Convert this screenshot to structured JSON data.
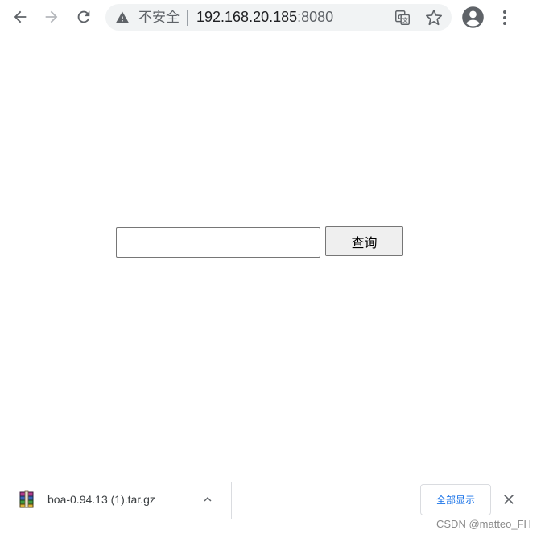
{
  "toolbar": {
    "back_icon": "arrow-back-icon",
    "forward_icon": "arrow-forward-icon",
    "reload_icon": "reload-icon",
    "omnibox": {
      "security_icon": "warning-triangle-icon",
      "security_label": "不安全",
      "url_host": "192.168.20.185",
      "url_port": ":8080",
      "translate_icon": "translate-icon",
      "bookmark_icon": "star-icon"
    },
    "profile_icon": "account-circle-icon",
    "menu_icon": "more-vert-icon"
  },
  "page": {
    "search": {
      "value": "",
      "placeholder": ""
    },
    "query_button_label": "查询"
  },
  "download_shelf": {
    "file_icon": "winrar-archive-icon",
    "file_name": "boa-0.94.13 (1).tar.gz",
    "chevron_icon": "chevron-up-icon",
    "show_all_label": "全部显示",
    "close_icon": "close-icon"
  },
  "watermark": "CSDN @matteo_FH",
  "colors": {
    "icon": "#5f6368",
    "omnibox_bg": "#f1f3f4",
    "link_blue": "#1a73e8"
  }
}
